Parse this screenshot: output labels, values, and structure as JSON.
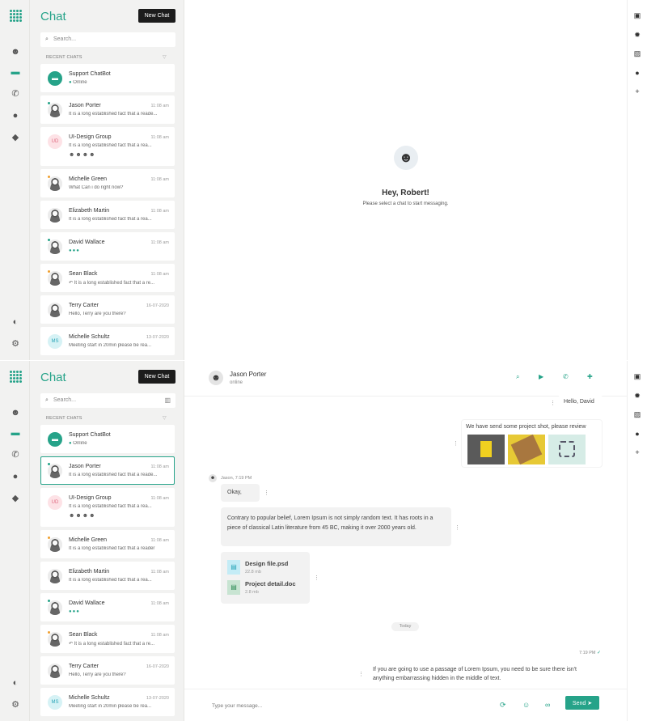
{
  "app": {
    "title": "Chat",
    "new_chat": "New Chat",
    "search_placeholder": "Search...",
    "recent_label": "RECENT CHATS"
  },
  "chats": [
    {
      "name": "Support ChatBot",
      "time": "",
      "preview": "Online",
      "avatar": "bot"
    },
    {
      "name": "Jason Porter",
      "time": "11:08 am",
      "preview": "It is a long established fact that a reade...",
      "avatar": "photo",
      "dot": "#26a389"
    },
    {
      "name": "UI-Design Group",
      "time": "11:08 am",
      "preview": "It is a long established fact that a rea...",
      "avatar": "UD"
    },
    {
      "name": "Michelle Green",
      "time": "11:08 am",
      "preview": "What Can i do right now?",
      "avatar": "photo",
      "dot": "#f0a030"
    },
    {
      "name": "Elizabeth Martin",
      "time": "11:08 am",
      "preview": "It is a long established fact that a rea...",
      "avatar": "photo"
    },
    {
      "name": "David Wallace",
      "time": "11:08 am",
      "preview": "●●●",
      "avatar": "photo",
      "dot": "#26a389"
    },
    {
      "name": "Sean Black",
      "time": "11:08 am",
      "preview": "↶ It is a long established fact that a re...",
      "avatar": "photo",
      "dot": "#f0a030"
    },
    {
      "name": "Terry Carter",
      "time": "16-07-2020",
      "preview": "Hello, Terry are you there?",
      "avatar": "photo"
    },
    {
      "name": "Michelle Schultz",
      "time": "13-07-2020",
      "preview": "Meeting start in 20min please be rea...",
      "avatar": "MS"
    }
  ],
  "chats2_overrides": {
    "jason_preview": "It is a long established fact that a reade...",
    "michelle_preview": "It is a long established fact that a reader",
    "elizabeth_preview": "It is a long established fact that a rea...",
    "sean_preview": "↶ It is a long established fact that a re...",
    "schultz_preview": "Meeting start in 20min please be rea..."
  },
  "welcome": {
    "title": "Hey, Robert!",
    "subtitle": "Please select a chat to start messaging."
  },
  "conversation": {
    "contact_name": "Jason Porter",
    "contact_status": "online",
    "msg_out1": "Hello, David",
    "msg_out2": "We have send some project shot, please review",
    "sender_meta": "Jason, 7:19 PM",
    "msg_in1": "Okay,",
    "msg_in2": "Contrary to popular belief, Lorem Ipsum is not simply random text. It has roots in a piece of classical Latin literature from 45 BC, making it over 2000 years old.",
    "file1_name": "Design file.psd",
    "file1_size": "22.8 mb",
    "file2_name": "Project detail.doc",
    "file2_size": "2.8 mb",
    "divider": "Today",
    "out_meta": "7:19 PM",
    "msg_out3": "If you are going to use a passage of Lorem Ipsum, you need to be sure there isn't anything embarrassing hidden in the middle of text.",
    "composer_placeholder": "Type your message...",
    "send": "Send"
  },
  "colors": {
    "accent": "#26a389",
    "dark": "#1c1c1c",
    "sidebar_bg": "#f2f2f1"
  }
}
